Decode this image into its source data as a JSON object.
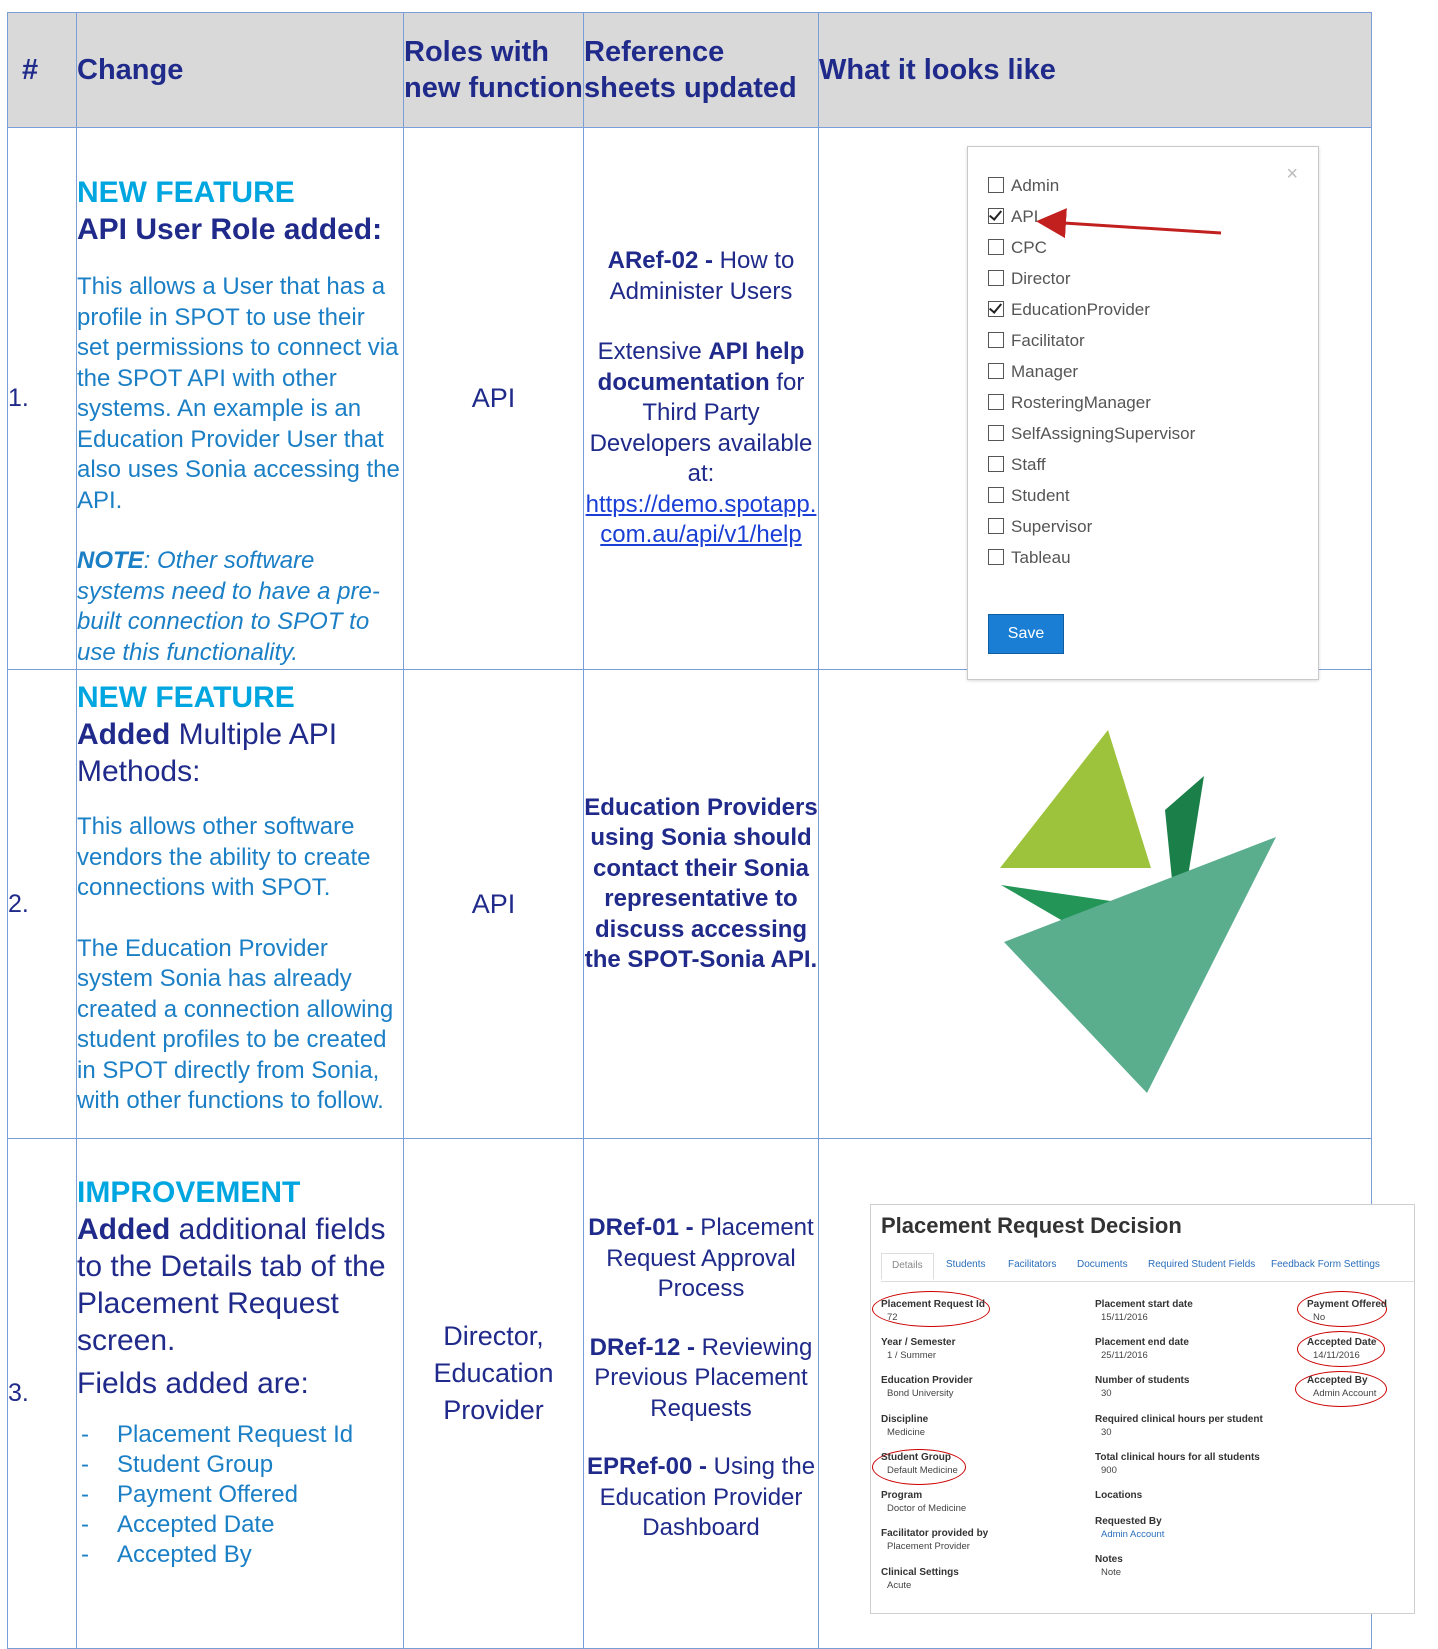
{
  "header": {
    "num": "#",
    "change": "Change",
    "roles": "Roles with new function",
    "refs": "Reference sheets updated",
    "looks": "What it looks like"
  },
  "rows": [
    {
      "num": "1.",
      "tag": "NEW FEATURE",
      "title": "API User Role added:",
      "desc": "This allows a User that has a profile in SPOT to use their set permissions to connect via the SPOT API with other systems. An example is an Education Provider User that also uses Sonia accessing the API.",
      "note_bold": "NOTE",
      "note_rest": ": Other software systems need to have a pre-built connection to SPOT to use this functionality.",
      "roles": "API",
      "ref_code": "ARef-02 -",
      "ref_title": " How to Administer Users",
      "ref2_a": "Extensive ",
      "ref2_b": "API help documentation",
      "ref2_c": " for Third Party Developers available at:",
      "link1": "https://demo.spotapp.",
      "link2": "com.au/api/v1/help"
    },
    {
      "num": "2.",
      "tag": "NEW FEATURE",
      "title_bold": "Added",
      "title_rest": " Multiple API Methods:",
      "desc1": "This allows other software vendors the ability to create connections with SPOT.",
      "desc2": "The Education Provider system Sonia has already created a connection allowing student profiles to be created in SPOT directly from Sonia, with other functions to follow.",
      "roles": "API",
      "refs": "Education Providers using Sonia should contact their Sonia representative to discuss accessing the SPOT-Sonia API."
    },
    {
      "num": "3.",
      "tag": "IMPROVEMENT",
      "title_bold": "Added",
      "title_rest": " additional fields to the Details tab of the Placement Request screen.",
      "fields_intro": "Fields added are:",
      "fields": [
        "Placement Request Id",
        "Student Group",
        "Payment Offered",
        "Accepted Date",
        "Accepted By"
      ],
      "roles": "Director, Education Provider",
      "refs": [
        {
          "code": "DRef-01 -",
          "title": " Placement Request Approval Process"
        },
        {
          "code": "DRef-12 -",
          "title": " Reviewing Previous Placement Requests"
        },
        {
          "code": "EPRef-00 -",
          "title": " Using the Education Provider Dashboard"
        }
      ]
    }
  ],
  "roles_dialog": {
    "close": "×",
    "options": [
      {
        "label": "Admin",
        "checked": false
      },
      {
        "label": "API",
        "checked": true
      },
      {
        "label": "CPC",
        "checked": false
      },
      {
        "label": "Director",
        "checked": false
      },
      {
        "label": "EducationProvider",
        "checked": true
      },
      {
        "label": "Facilitator",
        "checked": false
      },
      {
        "label": "Manager",
        "checked": false
      },
      {
        "label": "RosteringManager",
        "checked": false
      },
      {
        "label": "SelfAssigningSupervisor",
        "checked": false
      },
      {
        "label": "Staff",
        "checked": false
      },
      {
        "label": "Student",
        "checked": false
      },
      {
        "label": "Supervisor",
        "checked": false
      },
      {
        "label": "Tableau",
        "checked": false
      }
    ],
    "save": "Save"
  },
  "logo_colors": [
    "#9dc23b",
    "#1b7f4a",
    "#239657",
    "#5aae8e"
  ],
  "placement": {
    "title": "Placement Request Decision",
    "tabs": [
      "Details",
      "Students",
      "Facilitators",
      "Documents",
      "Required Student Fields",
      "Feedback Form Settings"
    ],
    "col1": [
      {
        "label": "Placement Request Id",
        "value": "72"
      },
      {
        "label": "Year / Semester",
        "value": "1 / Summer"
      },
      {
        "label": "Education Provider",
        "value": "Bond University"
      },
      {
        "label": "Discipline",
        "value": "Medicine"
      },
      {
        "label": "Student Group",
        "value": "Default Medicine"
      },
      {
        "label": "Program",
        "value": "Doctor of Medicine"
      },
      {
        "label": "Facilitator provided by",
        "value": "Placement Provider"
      },
      {
        "label": "Clinical Settings",
        "value": "Acute"
      }
    ],
    "col2": [
      {
        "label": "Placement start date",
        "value": "15/11/2016"
      },
      {
        "label": "Placement end date",
        "value": "25/11/2016"
      },
      {
        "label": "Number of students",
        "value": "30"
      },
      {
        "label": "Required clinical hours per student",
        "value": "30"
      },
      {
        "label": "Total clinical hours for all students",
        "value": "900"
      },
      {
        "label": "Locations",
        "value": ""
      },
      {
        "label": "Requested By",
        "value": "Admin Account"
      },
      {
        "label": "Notes",
        "value": "Note"
      }
    ],
    "col3": [
      {
        "label": "Payment Offered",
        "value": "No"
      },
      {
        "label": "Accepted Date",
        "value": "14/11/2016"
      },
      {
        "label": "Accepted By",
        "value": "Admin Account"
      }
    ]
  }
}
